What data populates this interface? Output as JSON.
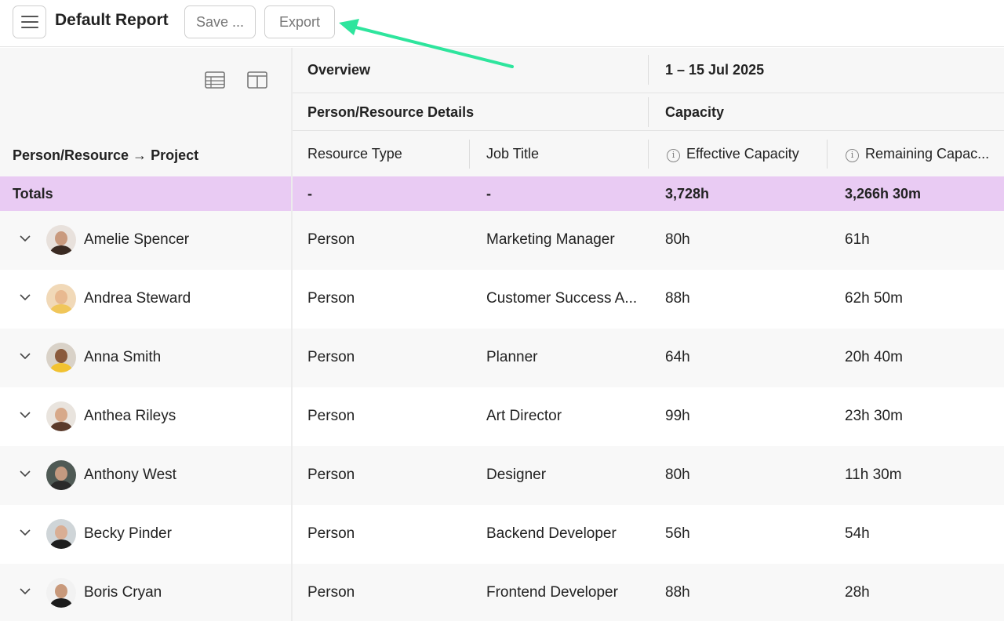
{
  "toolbar": {
    "title": "Default Report",
    "save_label": "Save ...",
    "export_label": "Export"
  },
  "left_header": {
    "column_label": "Person/Resource → Project",
    "icons": [
      "table-view-icon",
      "split-view-icon"
    ]
  },
  "header": {
    "overview_label": "Overview",
    "date_range": "1 – 15 Jul 2025",
    "group_details": "Person/Resource Details",
    "group_capacity": "Capacity",
    "col_resource_type": "Resource Type",
    "col_job_title": "Job Title",
    "col_effective": "Effective Capacity",
    "col_remaining": "Remaining Capac..."
  },
  "totals": {
    "label": "Totals",
    "resource_type": "-",
    "job_title": "-",
    "effective": "3,728h",
    "remaining": "3,266h 30m"
  },
  "rows": [
    {
      "name": "Amelie Spencer",
      "type": "Person",
      "job": "Marketing Manager",
      "effective": "80h",
      "remaining": "61h"
    },
    {
      "name": "Andrea Steward",
      "type": "Person",
      "job": "Customer Success A...",
      "effective": "88h",
      "remaining": "62h 50m"
    },
    {
      "name": "Anna Smith",
      "type": "Person",
      "job": "Planner",
      "effective": "64h",
      "remaining": "20h 40m"
    },
    {
      "name": "Anthea Rileys",
      "type": "Person",
      "job": "Art Director",
      "effective": "99h",
      "remaining": "23h 30m"
    },
    {
      "name": "Anthony West",
      "type": "Person",
      "job": "Designer",
      "effective": "80h",
      "remaining": "11h 30m"
    },
    {
      "name": "Becky Pinder",
      "type": "Person",
      "job": "Backend Developer",
      "effective": "56h",
      "remaining": "54h"
    },
    {
      "name": "Boris Cryan",
      "type": "Person",
      "job": "Frontend Developer",
      "effective": "88h",
      "remaining": "28h"
    }
  ],
  "colors": {
    "totals_bg": "#e9cbf3",
    "annotation_arrow": "#2ee59d"
  }
}
